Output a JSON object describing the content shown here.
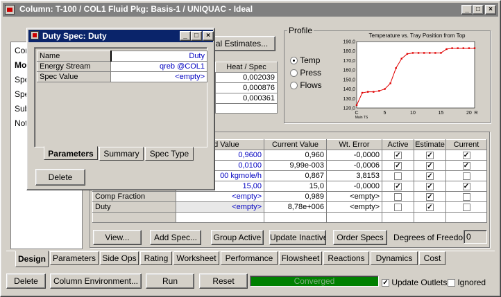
{
  "main_window": {
    "title": "Column: T-100 / COL1  Fluid Pkg: Basis-1 / UNIQUAC - Ideal",
    "minimize": "_",
    "maximize": "□",
    "close": "×"
  },
  "left_list": {
    "items": [
      "Con",
      "Mo",
      "Spe",
      "Spe",
      "Sub",
      "Not"
    ]
  },
  "estimates_button": "al Estimates...",
  "heat_spec": {
    "header": "Heat / Spec",
    "values": [
      "0,002039",
      "0,000876",
      "0,000361"
    ]
  },
  "profile": {
    "group_label": "Profile",
    "options": [
      {
        "label": "Temp",
        "selected": true
      },
      {
        "label": "Press",
        "selected": false
      },
      {
        "label": "Flows",
        "selected": false
      }
    ]
  },
  "chart_data": {
    "type": "line",
    "title": "Temperature vs. Tray Position from Top",
    "xlabel": "Main TS",
    "x_ticks": [
      "C",
      "5",
      "10",
      "15",
      "20",
      "R"
    ],
    "y_ticks": [
      "120,0",
      "130,0",
      "140,0",
      "150,0",
      "160,0",
      "170,0",
      "180,0",
      "190,0"
    ],
    "ylim": [
      120,
      190
    ],
    "xlim": [
      0,
      21
    ],
    "color": "#e00000",
    "x": [
      0,
      1,
      2,
      3,
      4,
      5,
      6,
      7,
      8,
      9,
      10,
      11,
      12,
      13,
      14,
      15,
      16,
      17,
      18,
      19,
      20,
      21
    ],
    "y": [
      123,
      136,
      137,
      137,
      138,
      140,
      146,
      162,
      172,
      177,
      178,
      178,
      178,
      178,
      178,
      178,
      182,
      183,
      183,
      183,
      183,
      183
    ]
  },
  "specs_table": {
    "headers": [
      "ed Value",
      "Current Value",
      "Wt. Error",
      "Active",
      "Estimate",
      "Current"
    ],
    "rows": [
      {
        "name": "",
        "spec": "0,9600",
        "current": "0,960",
        "error": "-0,0000",
        "active": true,
        "estimate": true,
        "cur": true
      },
      {
        "name": "",
        "spec": "0,0100",
        "current": "9,99e-003",
        "error": "-0,0006",
        "active": true,
        "estimate": true,
        "cur": true
      },
      {
        "name": "",
        "spec": "00 kgmole/h",
        "current": "0,867",
        "error": "3,8153",
        "active": false,
        "estimate": true,
        "cur": false
      },
      {
        "name": "",
        "spec": "15,00",
        "current": "15,0",
        "error": "-0,0000",
        "active": true,
        "estimate": true,
        "cur": true
      },
      {
        "name": "Comp Fraction",
        "spec": "<empty>",
        "current": "0,989",
        "error": "<empty>",
        "active": false,
        "estimate": true,
        "cur": false
      },
      {
        "name": "Duty",
        "spec": "<empty>",
        "current": "8,78e+006",
        "error": "<empty>",
        "active": false,
        "estimate": true,
        "cur": false
      },
      {
        "name": "",
        "spec": "",
        "current": "",
        "error": "",
        "active": null,
        "estimate": null,
        "cur": null
      }
    ]
  },
  "spec_buttons": {
    "view": "View...",
    "add_spec": "Add Spec...",
    "group_active": "Group Active",
    "update_inactive": "Update Inactive",
    "order_specs": "Order Specs",
    "dof_label": "Degrees of Freedom",
    "dof_value": "0"
  },
  "main_tabs": [
    "Design",
    "Parameters",
    "Side Ops",
    "Rating",
    "Worksheet",
    "Performance",
    "Flowsheet",
    "Reactions",
    "Dynamics",
    "Cost"
  ],
  "bottom_bar": {
    "delete": "Delete",
    "column_env": "Column Environment...",
    "run": "Run",
    "reset": "Reset",
    "status": "Converged",
    "status_color": "#008000",
    "update_outlets": "Update Outlets",
    "update_outlets_checked": true,
    "ignored": "Ignored",
    "ignored_checked": false
  },
  "dialog": {
    "title": "Duty Spec: Duty",
    "props": [
      {
        "label": "Name",
        "value": "Duty"
      },
      {
        "label": "Energy Stream",
        "value": "qreb @COL1"
      },
      {
        "label": "Spec Value",
        "value": "<empty>"
      }
    ],
    "tabs": [
      "Parameters",
      "Summary",
      "Spec Type"
    ],
    "delete": "Delete"
  }
}
